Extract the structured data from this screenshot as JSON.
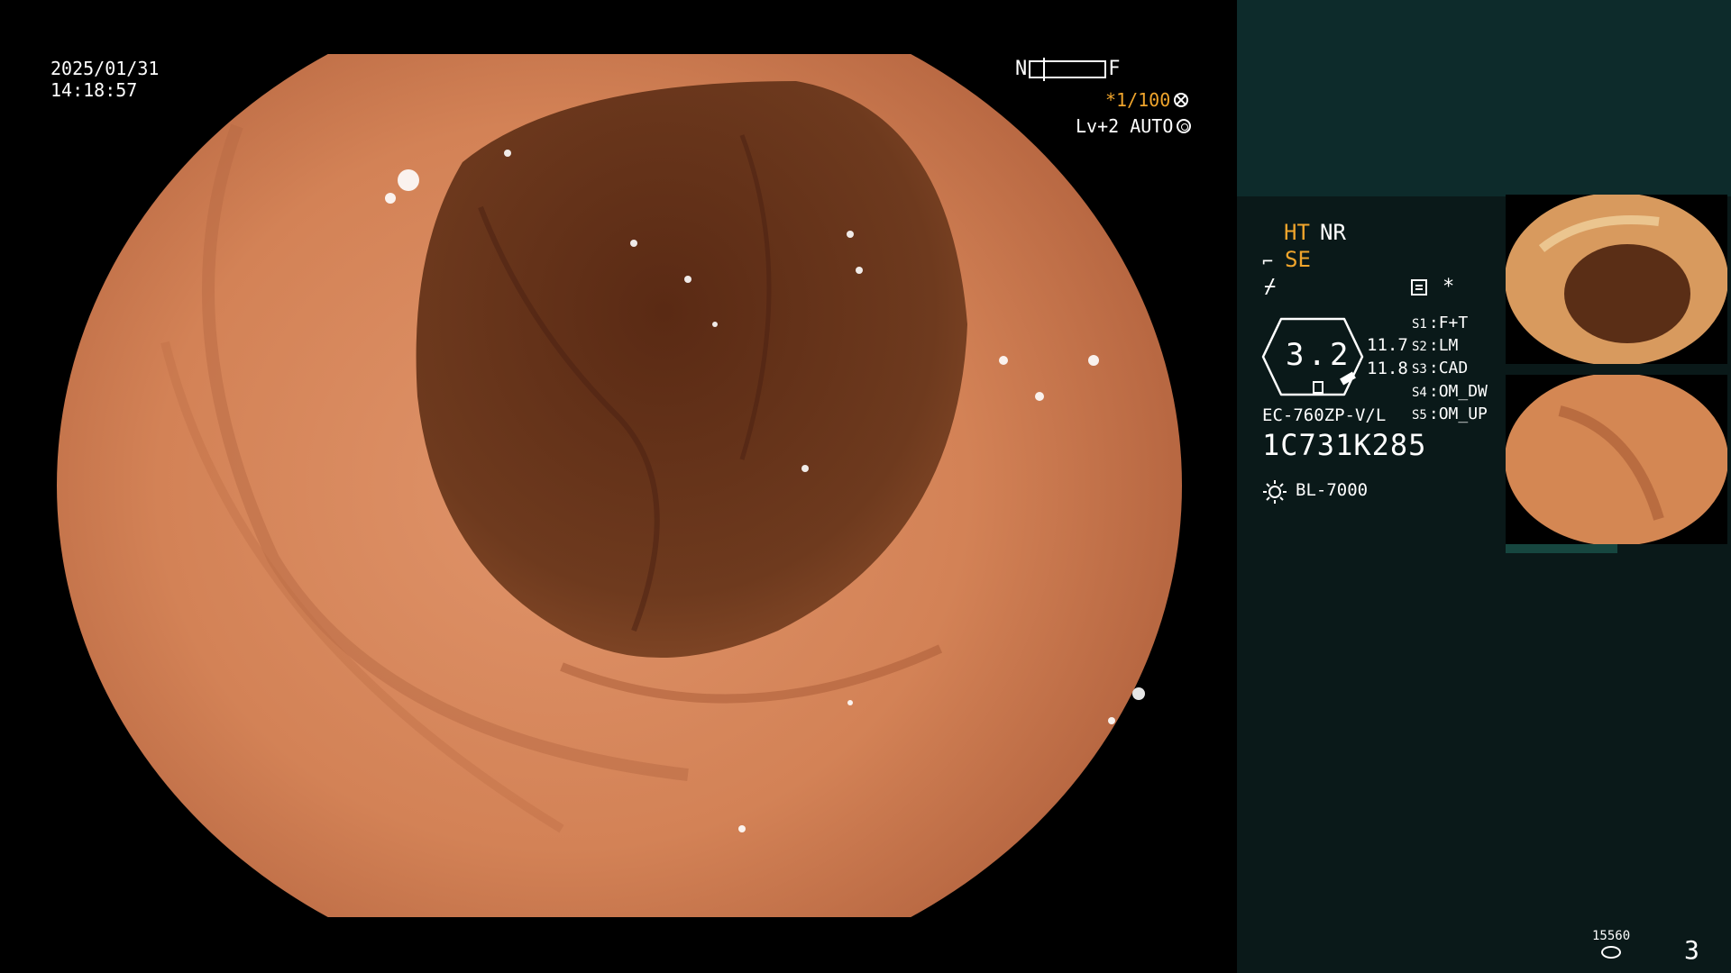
{
  "osd": {
    "date": "2025/01/31",
    "time": "14:18:57",
    "focus_near": "N",
    "focus_far": "F",
    "shutter": "*1/100",
    "agc": "Lv+2 AUTO"
  },
  "panel": {
    "ht": "HT",
    "nr": "NR",
    "se": "SE",
    "star": "*",
    "zoom": "3.2",
    "values": [
      "11.7",
      "11.8"
    ],
    "switches": [
      {
        "key": "S1",
        "label": "F+T"
      },
      {
        "key": "S2",
        "label": "LM"
      },
      {
        "key": "S3",
        "label": "CAD"
      },
      {
        "key": "S4",
        "label": "OM_DW"
      },
      {
        "key": "S5",
        "label": "OM_UP"
      }
    ],
    "scope_model": "EC-760ZP-V/L",
    "serial": "1C731K285",
    "light_source": "BL-7000",
    "capture_count": "15560",
    "page": "3"
  },
  "icons": {
    "se_icon": "scope-icon",
    "af_icon": "lightning-icon",
    "mode_icon": "menu-icon",
    "light_icon": "sun-icon",
    "count_icon": "disk-icon"
  },
  "colors": {
    "accent": "#f0a52c",
    "panel_bg": "#0a1919",
    "panel_top": "#0d2b2b",
    "tissue": "#d98a60",
    "lumen": "#4a2414"
  }
}
